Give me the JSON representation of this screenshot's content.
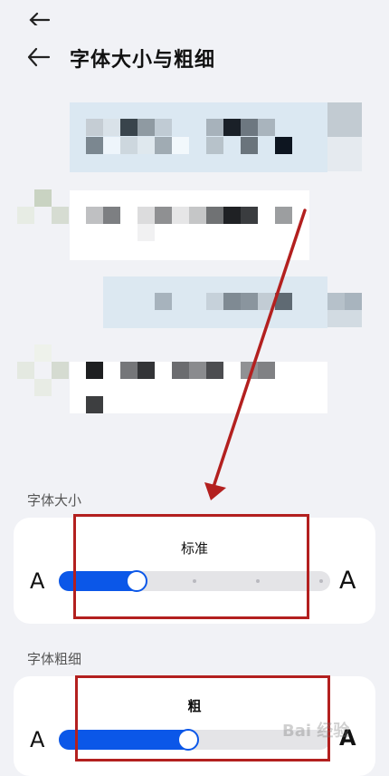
{
  "header": {
    "title": "字体大小与粗细"
  },
  "font_size": {
    "section_label": "字体大小",
    "value_label": "标准",
    "left_glyph": "A",
    "right_glyph": "A",
    "level_fraction": 0.28,
    "steps": 5
  },
  "font_weight": {
    "section_label": "字体粗细",
    "value_label": "粗",
    "left_glyph": "A",
    "right_glyph": "A",
    "level_fraction": 0.47
  },
  "watermark": {
    "text": "Bai 经验"
  },
  "colors": {
    "accent": "#0b57e8",
    "annotation_red": "#b3201f",
    "background": "#f1f2f6"
  }
}
